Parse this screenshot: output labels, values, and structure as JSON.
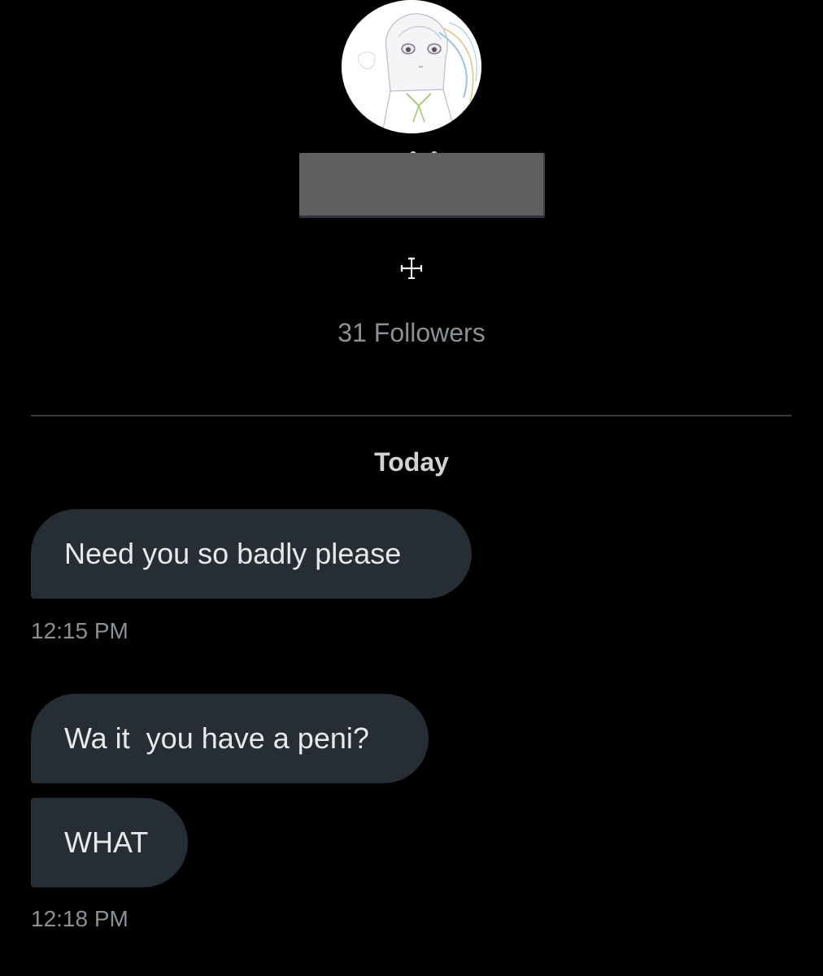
{
  "profile": {
    "avatar_icon": "anime-character-avatar",
    "bio_symbol": "☩",
    "followers_text": "31 Followers"
  },
  "conversation": {
    "day_label": "Today",
    "messages": [
      {
        "text": "Need you so badly please",
        "time": "12:15 PM"
      },
      {
        "text": "Wa it  you have a peni?",
        "time": ""
      },
      {
        "text": "WHAT",
        "time": "12:18 PM"
      }
    ]
  },
  "colors": {
    "background": "#000000",
    "bubble": "#262d34",
    "muted_text": "#8b9096",
    "divider": "#3a3d41"
  }
}
